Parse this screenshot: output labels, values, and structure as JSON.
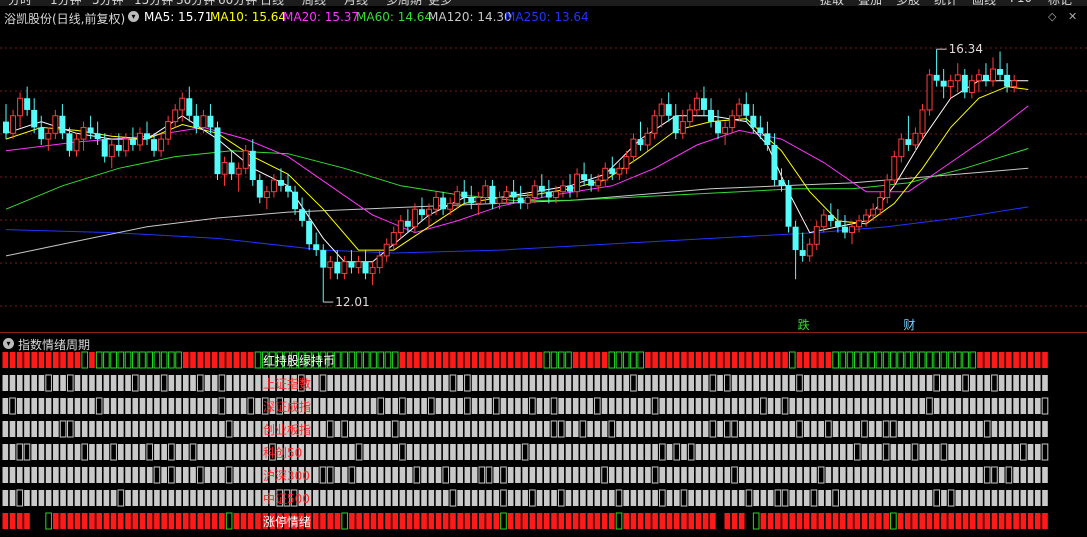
{
  "top_menu": [
    "分时",
    "1分钟",
    "5分钟",
    "15分钟",
    "30分钟",
    "60分钟",
    "日线",
    "周线",
    "月线",
    "多周期",
    "更多",
    "提取",
    "叠加",
    "多股",
    "统计",
    "画线",
    "F10",
    "标记"
  ],
  "header": {
    "stock_name": "浴凯股份(日线,前复权)",
    "ma5": "MA5: 15.71",
    "ma10": "MA10: 15.64",
    "ma20": "MA20: 15.37",
    "ma60": "MA60: 14.64",
    "ma120": "MA120: 14.30",
    "ma250": "MA250: 13.64"
  },
  "colors": {
    "up": "#ff3b3b",
    "down": "#54fcfc",
    "ma5": "#ffffff",
    "ma10": "#ffff00",
    "ma20": "#ff33ff",
    "ma60": "#33dd33",
    "ma120": "#c8c8c8",
    "ma250": "#2233ff",
    "grid": "#7a1a1a",
    "sub_red": "#ff1a1a",
    "sub_green": "#22dd22",
    "sub_gray": "#c9c9c9"
  },
  "chart_data": {
    "type": "candlestick",
    "ylim": [
      11.6,
      16.6
    ],
    "high_marker": "16.34",
    "low_marker": "12.01",
    "high": 16.34,
    "low": 12.01,
    "event_labels": [
      {
        "label": "跌",
        "index": 113
      },
      {
        "label": "财",
        "index": 128
      }
    ],
    "candles": [
      [
        15.1,
        15.4,
        14.8,
        14.9
      ],
      [
        14.9,
        15.3,
        14.8,
        15.2
      ],
      [
        15.2,
        15.6,
        15.0,
        15.5
      ],
      [
        15.5,
        15.7,
        15.2,
        15.3
      ],
      [
        15.3,
        15.5,
        14.9,
        15.0
      ],
      [
        15.0,
        15.2,
        14.7,
        14.8
      ],
      [
        14.8,
        15.0,
        14.6,
        14.9
      ],
      [
        14.9,
        15.3,
        14.8,
        15.2
      ],
      [
        15.2,
        15.4,
        14.8,
        14.9
      ],
      [
        14.9,
        15.0,
        14.5,
        14.6
      ],
      [
        14.6,
        14.9,
        14.5,
        14.8
      ],
      [
        14.8,
        15.1,
        14.6,
        15.0
      ],
      [
        15.0,
        15.2,
        14.8,
        14.9
      ],
      [
        14.9,
        15.1,
        14.7,
        14.8
      ],
      [
        14.8,
        14.9,
        14.4,
        14.5
      ],
      [
        14.5,
        14.8,
        14.3,
        14.7
      ],
      [
        14.7,
        14.9,
        14.5,
        14.6
      ],
      [
        14.6,
        14.9,
        14.5,
        14.8
      ],
      [
        14.8,
        15.0,
        14.6,
        14.7
      ],
      [
        14.7,
        15.0,
        14.6,
        14.9
      ],
      [
        14.9,
        15.1,
        14.7,
        14.8
      ],
      [
        14.8,
        14.9,
        14.5,
        14.6
      ],
      [
        14.6,
        14.9,
        14.5,
        14.8
      ],
      [
        14.8,
        15.2,
        14.7,
        15.1
      ],
      [
        15.1,
        15.4,
        15.0,
        15.3
      ],
      [
        15.3,
        15.6,
        15.1,
        15.5
      ],
      [
        15.5,
        15.7,
        15.1,
        15.2
      ],
      [
        15.2,
        15.4,
        14.9,
        15.0
      ],
      [
        15.0,
        15.3,
        14.9,
        15.2
      ],
      [
        15.2,
        15.4,
        14.9,
        15.0
      ],
      [
        15.0,
        15.1,
        14.1,
        14.2
      ],
      [
        14.2,
        14.5,
        14.0,
        14.4
      ],
      [
        14.4,
        14.6,
        14.1,
        14.2
      ],
      [
        14.2,
        14.4,
        13.9,
        14.3
      ],
      [
        14.3,
        14.7,
        14.2,
        14.6
      ],
      [
        14.6,
        14.8,
        14.0,
        14.1
      ],
      [
        14.1,
        14.2,
        13.7,
        13.8
      ],
      [
        13.8,
        14.0,
        13.6,
        13.9
      ],
      [
        13.9,
        14.2,
        13.8,
        14.1
      ],
      [
        14.1,
        14.3,
        13.9,
        14.0
      ],
      [
        14.0,
        14.2,
        13.8,
        13.9
      ],
      [
        13.9,
        14.0,
        13.5,
        13.6
      ],
      [
        13.6,
        13.8,
        13.3,
        13.4
      ],
      [
        13.4,
        13.6,
        12.9,
        13.0
      ],
      [
        13.0,
        13.2,
        12.8,
        12.9
      ],
      [
        12.9,
        13.0,
        12.01,
        12.6
      ],
      [
        12.6,
        12.8,
        12.4,
        12.7
      ],
      [
        12.7,
        12.9,
        12.4,
        12.5
      ],
      [
        12.5,
        12.8,
        12.4,
        12.7
      ],
      [
        12.7,
        12.9,
        12.5,
        12.6
      ],
      [
        12.6,
        12.8,
        12.5,
        12.7
      ],
      [
        12.7,
        12.9,
        12.4,
        12.5
      ],
      [
        12.5,
        12.7,
        12.3,
        12.6
      ],
      [
        12.6,
        12.9,
        12.5,
        12.8
      ],
      [
        12.8,
        13.1,
        12.7,
        13.0
      ],
      [
        13.0,
        13.3,
        12.9,
        13.2
      ],
      [
        13.2,
        13.5,
        13.1,
        13.4
      ],
      [
        13.4,
        13.6,
        13.2,
        13.3
      ],
      [
        13.3,
        13.7,
        13.2,
        13.6
      ],
      [
        13.6,
        13.8,
        13.4,
        13.5
      ],
      [
        13.5,
        13.7,
        13.3,
        13.6
      ],
      [
        13.6,
        13.9,
        13.5,
        13.8
      ],
      [
        13.8,
        13.9,
        13.5,
        13.6
      ],
      [
        13.6,
        13.8,
        13.5,
        13.7
      ],
      [
        13.7,
        14.0,
        13.6,
        13.9
      ],
      [
        13.9,
        14.1,
        13.7,
        13.8
      ],
      [
        13.8,
        14.0,
        13.6,
        13.7
      ],
      [
        13.7,
        13.9,
        13.5,
        13.8
      ],
      [
        13.8,
        14.1,
        13.7,
        14.0
      ],
      [
        14.0,
        14.1,
        13.6,
        13.7
      ],
      [
        13.7,
        13.9,
        13.6,
        13.8
      ],
      [
        13.8,
        14.0,
        13.7,
        13.9
      ],
      [
        13.9,
        14.1,
        13.7,
        13.8
      ],
      [
        13.8,
        14.0,
        13.6,
        13.7
      ],
      [
        13.7,
        13.9,
        13.6,
        13.8
      ],
      [
        13.8,
        14.1,
        13.7,
        14.0
      ],
      [
        14.0,
        14.2,
        13.8,
        13.9
      ],
      [
        13.9,
        14.1,
        13.7,
        13.8
      ],
      [
        13.8,
        14.0,
        13.7,
        13.9
      ],
      [
        13.9,
        14.1,
        13.8,
        14.0
      ],
      [
        14.0,
        14.2,
        13.8,
        13.9
      ],
      [
        13.9,
        14.3,
        13.8,
        14.2
      ],
      [
        14.2,
        14.4,
        14.0,
        14.1
      ],
      [
        14.1,
        14.2,
        13.9,
        14.0
      ],
      [
        14.0,
        14.2,
        13.9,
        14.1
      ],
      [
        14.1,
        14.4,
        14.0,
        14.3
      ],
      [
        14.3,
        14.5,
        14.1,
        14.2
      ],
      [
        14.2,
        14.4,
        14.1,
        14.3
      ],
      [
        14.3,
        14.6,
        14.2,
        14.5
      ],
      [
        14.5,
        14.9,
        14.4,
        14.8
      ],
      [
        14.8,
        15.1,
        14.6,
        14.7
      ],
      [
        14.7,
        15.0,
        14.6,
        14.9
      ],
      [
        14.9,
        15.3,
        14.8,
        15.2
      ],
      [
        15.2,
        15.5,
        15.0,
        15.4
      ],
      [
        15.4,
        15.6,
        15.1,
        15.2
      ],
      [
        15.2,
        15.4,
        14.8,
        14.9
      ],
      [
        14.9,
        15.3,
        14.8,
        15.1
      ],
      [
        15.1,
        15.4,
        15.0,
        15.3
      ],
      [
        15.3,
        15.6,
        15.2,
        15.5
      ],
      [
        15.5,
        15.7,
        15.2,
        15.3
      ],
      [
        15.3,
        15.5,
        15.0,
        15.1
      ],
      [
        15.1,
        15.3,
        14.8,
        14.9
      ],
      [
        14.9,
        15.1,
        14.7,
        15.0
      ],
      [
        15.0,
        15.3,
        14.9,
        15.2
      ],
      [
        15.2,
        15.5,
        15.1,
        15.4
      ],
      [
        15.4,
        15.6,
        15.1,
        15.2
      ],
      [
        15.2,
        15.4,
        14.9,
        15.0
      ],
      [
        15.0,
        15.2,
        14.8,
        14.9
      ],
      [
        14.9,
        15.1,
        14.6,
        14.7
      ],
      [
        14.7,
        14.9,
        14.0,
        14.1
      ],
      [
        14.1,
        14.3,
        13.9,
        14.0
      ],
      [
        14.0,
        14.1,
        13.2,
        13.3
      ],
      [
        13.3,
        13.4,
        12.4,
        12.9
      ],
      [
        12.9,
        13.2,
        12.7,
        12.8
      ],
      [
        12.8,
        13.1,
        12.7,
        13.0
      ],
      [
        13.0,
        13.4,
        12.9,
        13.3
      ],
      [
        13.3,
        13.6,
        13.2,
        13.5
      ],
      [
        13.5,
        13.7,
        13.3,
        13.4
      ],
      [
        13.4,
        13.6,
        13.2,
        13.3
      ],
      [
        13.3,
        13.5,
        13.1,
        13.2
      ],
      [
        13.2,
        13.4,
        13.0,
        13.3
      ],
      [
        13.3,
        13.5,
        13.2,
        13.4
      ],
      [
        13.4,
        13.6,
        13.3,
        13.5
      ],
      [
        13.5,
        13.7,
        13.4,
        13.6
      ],
      [
        13.6,
        13.9,
        13.5,
        13.8
      ],
      [
        13.8,
        14.2,
        13.7,
        14.1
      ],
      [
        14.1,
        14.6,
        14.0,
        14.5
      ],
      [
        14.5,
        14.9,
        14.4,
        14.8
      ],
      [
        14.8,
        15.2,
        14.6,
        14.7
      ],
      [
        14.7,
        15.0,
        14.6,
        14.9
      ],
      [
        14.9,
        15.4,
        14.8,
        15.3
      ],
      [
        15.3,
        16.0,
        15.2,
        15.9
      ],
      [
        15.9,
        16.34,
        15.7,
        15.8
      ],
      [
        15.8,
        16.0,
        15.5,
        15.7
      ],
      [
        15.7,
        15.9,
        15.5,
        15.8
      ],
      [
        15.8,
        16.1,
        15.6,
        15.9
      ],
      [
        15.9,
        16.0,
        15.5,
        15.6
      ],
      [
        15.6,
        15.9,
        15.5,
        15.8
      ],
      [
        15.8,
        16.0,
        15.6,
        15.9
      ],
      [
        15.9,
        16.1,
        15.7,
        15.8
      ],
      [
        15.8,
        16.2,
        15.7,
        16.0
      ],
      [
        16.0,
        16.3,
        15.8,
        15.9
      ],
      [
        15.9,
        16.1,
        15.6,
        15.7
      ],
      [
        15.7,
        15.9,
        15.6,
        15.8
      ]
    ],
    "ma_series": {
      "ma5": [
        [
          0,
          14.9
        ],
        [
          5,
          15.1
        ],
        [
          10,
          14.9
        ],
        [
          15,
          14.8
        ],
        [
          20,
          14.8
        ],
        [
          25,
          15.2
        ],
        [
          30,
          14.8
        ],
        [
          35,
          14.3
        ],
        [
          40,
          14.0
        ],
        [
          45,
          13.1
        ],
        [
          48,
          12.7
        ],
        [
          52,
          12.7
        ],
        [
          56,
          13.1
        ],
        [
          60,
          13.5
        ],
        [
          65,
          13.8
        ],
        [
          70,
          13.8
        ],
        [
          75,
          13.9
        ],
        [
          80,
          14.0
        ],
        [
          85,
          14.2
        ],
        [
          90,
          14.8
        ],
        [
          95,
          15.2
        ],
        [
          100,
          15.2
        ],
        [
          105,
          15.1
        ],
        [
          108,
          14.7
        ],
        [
          111,
          13.9
        ],
        [
          114,
          13.2
        ],
        [
          118,
          13.3
        ],
        [
          122,
          13.4
        ],
        [
          126,
          14.0
        ],
        [
          130,
          14.8
        ],
        [
          134,
          15.5
        ],
        [
          138,
          15.8
        ],
        [
          142,
          15.8
        ],
        [
          145,
          15.8
        ]
      ],
      "ma10": [
        [
          0,
          14.8
        ],
        [
          5,
          15.0
        ],
        [
          10,
          14.95
        ],
        [
          15,
          14.85
        ],
        [
          20,
          14.8
        ],
        [
          25,
          15.05
        ],
        [
          30,
          14.9
        ],
        [
          35,
          14.5
        ],
        [
          40,
          14.2
        ],
        [
          45,
          13.6
        ],
        [
          50,
          12.9
        ],
        [
          55,
          12.9
        ],
        [
          60,
          13.3
        ],
        [
          65,
          13.7
        ],
        [
          70,
          13.8
        ],
        [
          75,
          13.85
        ],
        [
          80,
          13.95
        ],
        [
          85,
          14.1
        ],
        [
          90,
          14.5
        ],
        [
          95,
          14.95
        ],
        [
          100,
          15.1
        ],
        [
          105,
          15.15
        ],
        [
          110,
          14.6
        ],
        [
          114,
          13.9
        ],
        [
          118,
          13.4
        ],
        [
          122,
          13.35
        ],
        [
          126,
          13.7
        ],
        [
          130,
          14.3
        ],
        [
          134,
          15.0
        ],
        [
          138,
          15.5
        ],
        [
          142,
          15.7
        ],
        [
          145,
          15.65
        ]
      ],
      "ma20": [
        [
          0,
          14.6
        ],
        [
          10,
          14.75
        ],
        [
          20,
          14.85
        ],
        [
          28,
          15.0
        ],
        [
          34,
          14.8
        ],
        [
          40,
          14.5
        ],
        [
          46,
          14.0
        ],
        [
          52,
          13.5
        ],
        [
          58,
          13.2
        ],
        [
          64,
          13.4
        ],
        [
          70,
          13.65
        ],
        [
          78,
          13.85
        ],
        [
          86,
          14.0
        ],
        [
          92,
          14.3
        ],
        [
          98,
          14.7
        ],
        [
          104,
          14.95
        ],
        [
          110,
          14.8
        ],
        [
          116,
          14.4
        ],
        [
          122,
          13.9
        ],
        [
          128,
          13.9
        ],
        [
          134,
          14.4
        ],
        [
          140,
          14.9
        ],
        [
          145,
          15.37
        ]
      ],
      "ma60": [
        [
          0,
          13.6
        ],
        [
          8,
          14.0
        ],
        [
          16,
          14.3
        ],
        [
          24,
          14.5
        ],
        [
          32,
          14.6
        ],
        [
          40,
          14.55
        ],
        [
          48,
          14.3
        ],
        [
          56,
          14.0
        ],
        [
          64,
          13.85
        ],
        [
          72,
          13.75
        ],
        [
          80,
          13.75
        ],
        [
          88,
          13.8
        ],
        [
          96,
          13.85
        ],
        [
          104,
          13.9
        ],
        [
          112,
          13.95
        ],
        [
          120,
          13.95
        ],
        [
          128,
          14.05
        ],
        [
          136,
          14.3
        ],
        [
          145,
          14.64
        ]
      ],
      "ma120": [
        [
          0,
          12.8
        ],
        [
          10,
          13.05
        ],
        [
          20,
          13.3
        ],
        [
          30,
          13.45
        ],
        [
          40,
          13.55
        ],
        [
          50,
          13.6
        ],
        [
          60,
          13.65
        ],
        [
          70,
          13.7
        ],
        [
          80,
          13.75
        ],
        [
          90,
          13.85
        ],
        [
          100,
          13.95
        ],
        [
          110,
          14.0
        ],
        [
          120,
          14.05
        ],
        [
          130,
          14.15
        ],
        [
          140,
          14.25
        ],
        [
          145,
          14.3
        ]
      ],
      "ma250": [
        [
          0,
          13.25
        ],
        [
          15,
          13.2
        ],
        [
          30,
          13.1
        ],
        [
          45,
          12.9
        ],
        [
          55,
          12.85
        ],
        [
          70,
          12.9
        ],
        [
          85,
          13.0
        ],
        [
          100,
          13.1
        ],
        [
          115,
          13.2
        ],
        [
          125,
          13.3
        ],
        [
          135,
          13.45
        ],
        [
          145,
          13.64
        ]
      ]
    }
  },
  "sub_panel": {
    "title": "指数情绪周期",
    "rows": [
      {
        "label": "红持股绿持币",
        "color": "#ffffff"
      },
      {
        "label": "上证指数",
        "color": "#ff2a2a"
      },
      {
        "label": "深证成指",
        "color": "#ff2a2a"
      },
      {
        "label": "创业板指",
        "color": "#ff2a2a"
      },
      {
        "label": "科创50",
        "color": "#ff2a2a"
      },
      {
        "label": "沪深300",
        "color": "#ff2a2a"
      },
      {
        "label": "中证500",
        "color": "#ff2a2a"
      },
      {
        "label": "涨停情绪",
        "color": "#ffffff"
      }
    ],
    "row0_pattern": "RRRRRRRRRRRGRGGGGGGGGGGGGRRRRRRRRRRGGGGGGGGGGGGGGGGGGGGRRRRRRRRRRRRRRRRRRRRGGGGRRRRRGGGGGRRRRRRRRRRRRRRRRRRRRGRRRRRGGGGGGGGGGGGGGGGGGGGRRRRRRRRRRRRRRRRRRRRRRRRRRRRRRRRRRRRRRRRRRRRRRGGGG",
    "row7_pattern": "RRRR..GRRRRRRRRRRRRRRRRRRRRRRRRGRRRRRRRRRRRRRRRGRRRRRRRRRRRRRRRRRRRRRGRRRRRRRRRRRRRRRGRRRRRRRRRRRRR.RRR.GRRRRRRRRRRRRRRRRRRGRRRRRRRRRRRRRRRRRRRRRRRRRRRRRRRRRRRRRRRRRRRRRRR"
  }
}
